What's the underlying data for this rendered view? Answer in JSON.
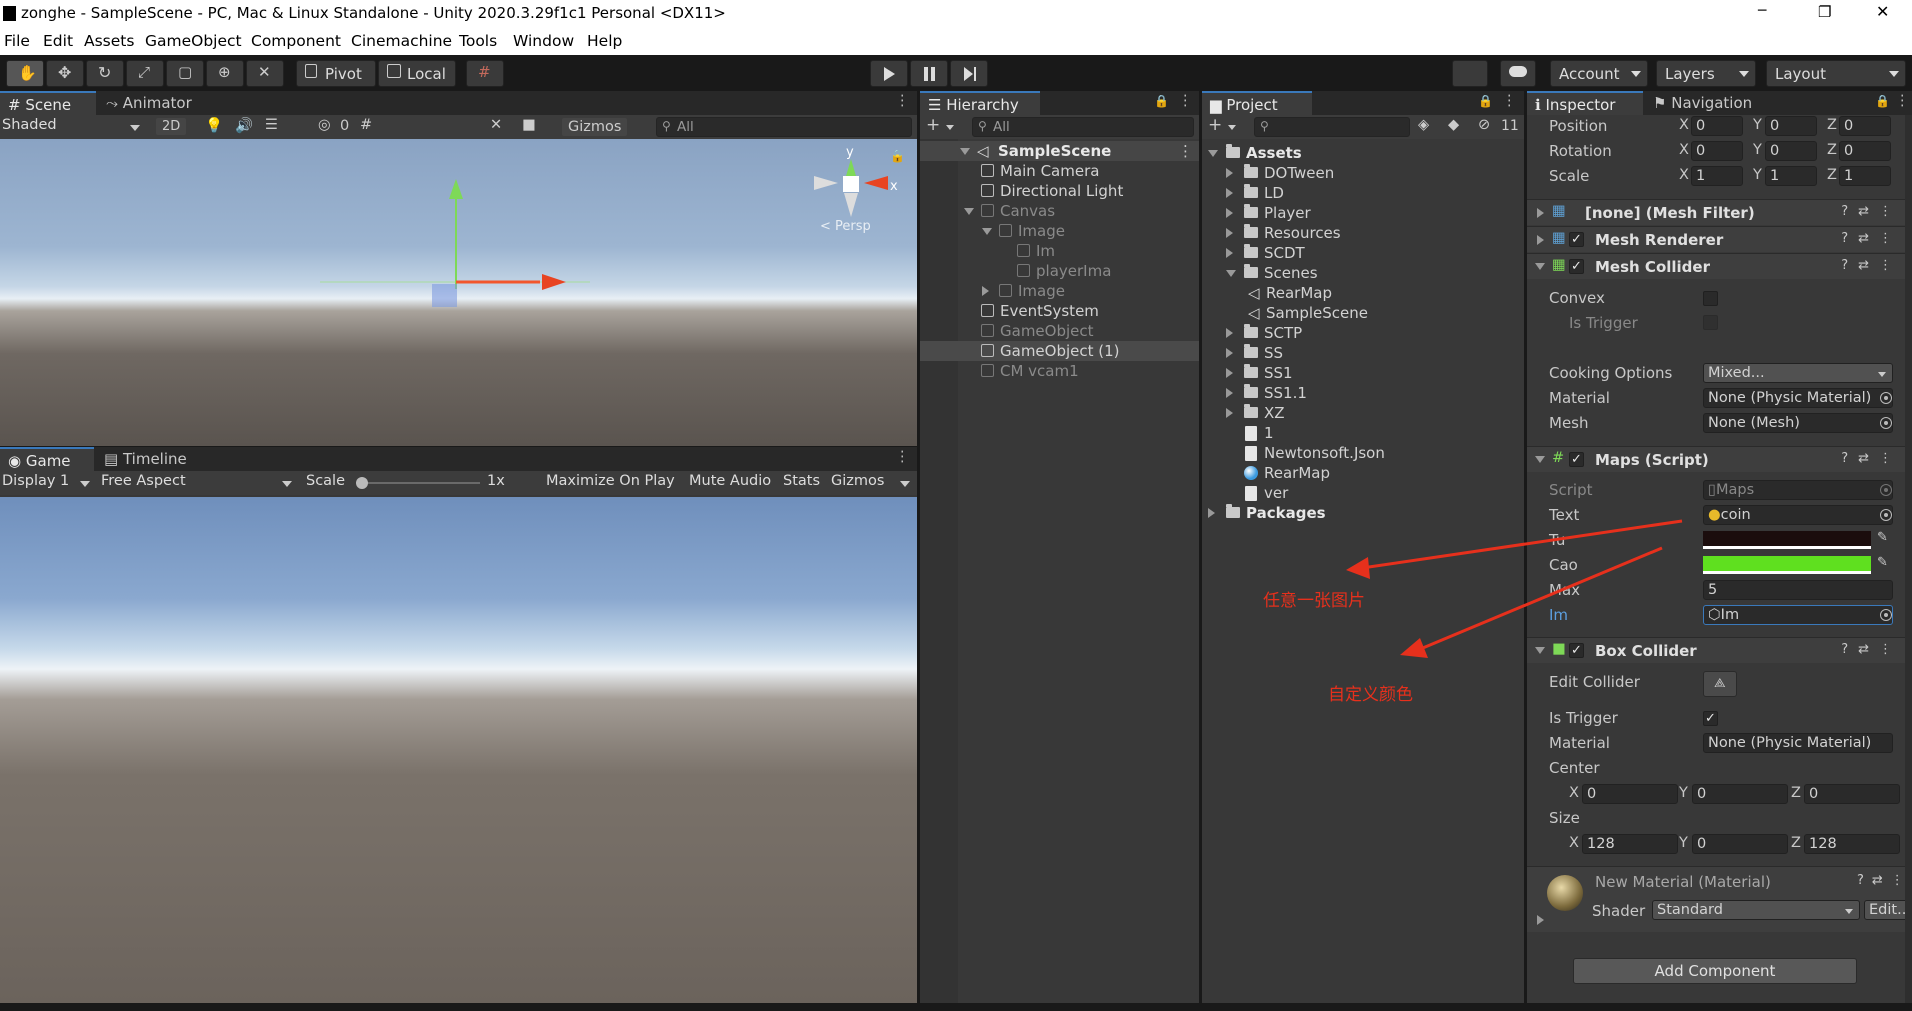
{
  "window": {
    "title": "zonghe - SampleScene - PC, Mac & Linux Standalone - Unity 2020.3.29f1c1 Personal <DX11>",
    "minimize": "─",
    "maximize": "❐",
    "close": "✕"
  },
  "menu": [
    "File",
    "Edit",
    "Assets",
    "GameObject",
    "Component",
    "Cinemachine",
    "Tools",
    "Window",
    "Help"
  ],
  "toolbar": {
    "pivot": "Pivot",
    "local": "Local",
    "account": "Account",
    "layers": "Layers",
    "layout": "Layout"
  },
  "scene": {
    "tabs": [
      "Scene",
      "Animator"
    ],
    "shading": "Shaded",
    "mode2d": "2D",
    "hidden_count": "0",
    "gizmos": "Gizmos",
    "search_placeholder": "All",
    "gizmo_y": "y",
    "gizmo_x": "x",
    "persp": "< Persp"
  },
  "game": {
    "tabs": [
      "Game",
      "Timeline"
    ],
    "display": "Display 1",
    "aspect": "Free Aspect",
    "scale_label": "Scale",
    "scale_value": "1x",
    "scale_fraction": 0,
    "maximize": "Maximize On Play",
    "mute": "Mute Audio",
    "stats": "Stats",
    "gizmos": "Gizmos"
  },
  "hierarchy": {
    "tab": "Hierarchy",
    "search_placeholder": "All",
    "scene": "SampleScene",
    "items": [
      {
        "label": "Main Camera",
        "depth": 1,
        "dim": false,
        "arrow": "none",
        "selected": false
      },
      {
        "label": "Directional Light",
        "depth": 1,
        "dim": false,
        "arrow": "none",
        "selected": false
      },
      {
        "label": "Canvas",
        "depth": 1,
        "dim": true,
        "arrow": "down",
        "selected": false
      },
      {
        "label": "Image",
        "depth": 2,
        "dim": true,
        "arrow": "down",
        "selected": false
      },
      {
        "label": "Im",
        "depth": 3,
        "dim": true,
        "arrow": "none",
        "selected": false
      },
      {
        "label": "playerIma",
        "depth": 3,
        "dim": true,
        "arrow": "none",
        "selected": false
      },
      {
        "label": "Image",
        "depth": 2,
        "dim": true,
        "arrow": "right",
        "selected": false
      },
      {
        "label": "EventSystem",
        "depth": 1,
        "dim": false,
        "arrow": "none",
        "selected": false
      },
      {
        "label": "GameObject",
        "depth": 1,
        "dim": true,
        "arrow": "none",
        "selected": false
      },
      {
        "label": "GameObject (1)",
        "depth": 1,
        "dim": false,
        "arrow": "none",
        "selected": true
      },
      {
        "label": "CM vcam1",
        "depth": 1,
        "dim": true,
        "arrow": "none",
        "selected": false
      }
    ]
  },
  "project": {
    "tab": "Project",
    "hidden_count": "11",
    "items": [
      {
        "label": "Assets",
        "depth": 0,
        "type": "folder",
        "arrow": "down",
        "bold": true
      },
      {
        "label": "DOTween",
        "depth": 1,
        "type": "folder",
        "arrow": "right"
      },
      {
        "label": "LD",
        "depth": 1,
        "type": "folder",
        "arrow": "right"
      },
      {
        "label": "Player",
        "depth": 1,
        "type": "folder",
        "arrow": "right"
      },
      {
        "label": "Resources",
        "depth": 1,
        "type": "folder",
        "arrow": "right"
      },
      {
        "label": "SCDT",
        "depth": 1,
        "type": "folder",
        "arrow": "right"
      },
      {
        "label": "Scenes",
        "depth": 1,
        "type": "folder",
        "arrow": "down"
      },
      {
        "label": "RearMap",
        "depth": 2,
        "type": "scene",
        "arrow": "none"
      },
      {
        "label": "SampleScene",
        "depth": 2,
        "type": "scene",
        "arrow": "none"
      },
      {
        "label": "SCTP",
        "depth": 1,
        "type": "folder",
        "arrow": "right"
      },
      {
        "label": "SS",
        "depth": 1,
        "type": "folder",
        "arrow": "right"
      },
      {
        "label": "SS1",
        "depth": 1,
        "type": "folder",
        "arrow": "right"
      },
      {
        "label": "SS1.1",
        "depth": 1,
        "type": "folder",
        "arrow": "right"
      },
      {
        "label": "XZ",
        "depth": 1,
        "type": "folder",
        "arrow": "right"
      },
      {
        "label": "1",
        "depth": 1,
        "type": "file",
        "arrow": "none"
      },
      {
        "label": "Newtonsoft.Json",
        "depth": 1,
        "type": "file",
        "arrow": "none"
      },
      {
        "label": "RearMap",
        "depth": 1,
        "type": "sphere",
        "arrow": "none"
      },
      {
        "label": "ver",
        "depth": 1,
        "type": "file",
        "arrow": "none"
      },
      {
        "label": "Packages",
        "depth": 0,
        "type": "folder",
        "arrow": "right",
        "bold": true
      }
    ]
  },
  "inspector": {
    "tabs": [
      "Inspector",
      "Navigation"
    ],
    "transform": {
      "position": {
        "label": "Position",
        "x": "0",
        "y": "0",
        "z": "0"
      },
      "rotation": {
        "label": "Rotation",
        "x": "0",
        "y": "0",
        "z": "0"
      },
      "scale": {
        "label": "Scale",
        "x": "1",
        "y": "1",
        "z": "1"
      }
    },
    "axis": {
      "x": "X",
      "y": "Y",
      "z": "Z"
    },
    "mesh_filter": "[none] (Mesh Filter)",
    "mesh_renderer": "Mesh Renderer",
    "mesh_collider": {
      "title": "Mesh Collider",
      "convex": "Convex",
      "is_trigger": "Is Trigger",
      "cooking_label": "Cooking Options",
      "cooking_value": "Mixed...",
      "material_label": "Material",
      "material_value": "None (Physic Material)",
      "mesh_label": "Mesh",
      "mesh_value": "None (Mesh)"
    },
    "maps": {
      "title": "Maps (Script)",
      "script_label": "Script",
      "script_value": "Maps",
      "text_label": "Text",
      "text_value": "coin",
      "tu_label": "Tu",
      "tu_color": "#1b0d0d",
      "cao_label": "Cao",
      "cao_color": "#5fe01f",
      "max_label": "Max",
      "max_value": "5",
      "im_label": "Im",
      "im_value": "Im"
    },
    "box_collider": {
      "title": "Box Collider",
      "edit_collider": "Edit Collider",
      "is_trigger": "Is Trigger",
      "material_label": "Material",
      "material_value": "None (Physic Material)",
      "center_label": "Center",
      "center": {
        "x": "0",
        "y": "0",
        "z": "0"
      },
      "size_label": "Size",
      "size": {
        "x": "128",
        "y": "0",
        "z": "128"
      }
    },
    "material": {
      "name": "New Material (Material)",
      "shader_label": "Shader",
      "shader_value": "Standard",
      "edit": "Edit..."
    },
    "add_component": "Add Component"
  },
  "annotations": {
    "image": "任意一张图片",
    "color": "自定义颜色"
  },
  "colors": {
    "accent": "#3a79bb",
    "annotation": "#e6301c"
  }
}
